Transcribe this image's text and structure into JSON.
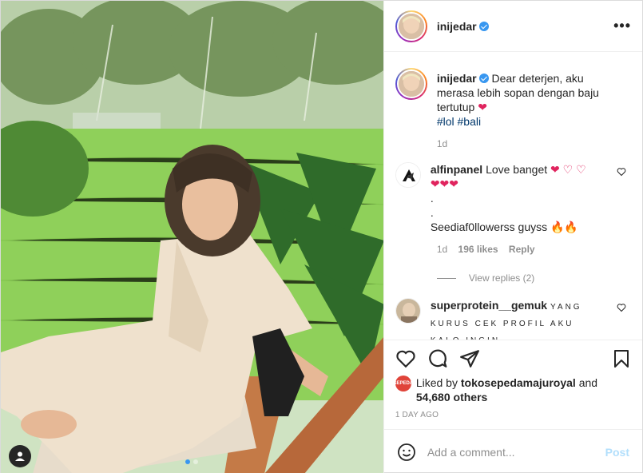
{
  "post": {
    "username": "inijedar",
    "verified": true,
    "more_label": "•••",
    "photo_count": 2,
    "active_photo": 1,
    "user_tag_icon": "user-icon"
  },
  "caption": {
    "username": "inijedar",
    "text": "Dear deterjen, aku merasa lebih sopan dengan baju tertutup",
    "emoji": "❤",
    "hashtags": [
      "#lol",
      "#bali"
    ],
    "age": "1d"
  },
  "comments": [
    {
      "username": "alfinpanel",
      "text_line1": "Love banget",
      "emoji_line1": "❤ ♡ ♡",
      "emoji_line2": "❤❤❤",
      "dot1": ".",
      "dot2": ".",
      "text_line3": "Seediaf0llowerss guyss",
      "emoji_line3": "🔥🔥",
      "age": "1d",
      "likes": "196 likes",
      "reply": "Reply",
      "view_replies": "View replies (2)"
    },
    {
      "username": "superprotein__gemuk",
      "text": "YANG KURUS CEK PROFIL AKU KALO INGIN"
    }
  ],
  "likes": {
    "prefix": "Liked by",
    "user": "tokosepedamajuroyal",
    "and": "and",
    "others": "54,680 others",
    "avatar_text": "SEPEDA"
  },
  "timestamp": "1 DAY AGO",
  "add_comment": {
    "placeholder": "Add a comment...",
    "post_label": "Post"
  },
  "colors": {
    "accent": "#3897f0",
    "link": "#00376b",
    "muted": "#8e8e8e",
    "heart": "#e0245e",
    "post_disabled": "#b2dffc"
  }
}
